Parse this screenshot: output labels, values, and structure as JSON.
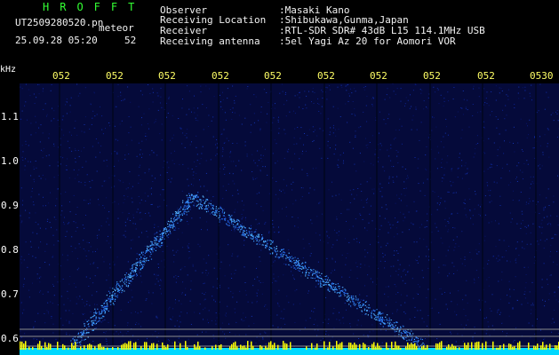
{
  "header": {
    "brand": "HROFFT",
    "filename": "UT2509280520.pn",
    "detection": "meteor",
    "timestamp": "25.09.28 05:20",
    "count": "52",
    "fields": [
      {
        "label": "Observer",
        "value": ":Masaki Kano"
      },
      {
        "label": "Receiving Location",
        "value": ":Shibukawa,Gunma,Japan"
      },
      {
        "label": "Receiver",
        "value": ":RTL-SDR SDR# 43dB L15 114.1MHz USB"
      },
      {
        "label": "Receiving antenna",
        "value": ":5el Yagi Az 20 for Aomori VOR"
      }
    ]
  },
  "axis": {
    "unit": "kHz",
    "y_labels": [
      "1.1",
      "1.0",
      "0.9",
      "0.8",
      "0.7",
      "0.6"
    ],
    "x_labels": [
      "052",
      "052",
      "052",
      "052",
      "052",
      "052",
      "052",
      "052",
      "052",
      "0530"
    ]
  },
  "colors": {
    "background": "#000000",
    "spectrum_base": "#0a1a6a",
    "signal": "#3aa0ff",
    "noise_band": "#00d8ff",
    "peak": "#ffff00",
    "tick_text": "#ffff66",
    "brand": "#33ff33"
  }
}
